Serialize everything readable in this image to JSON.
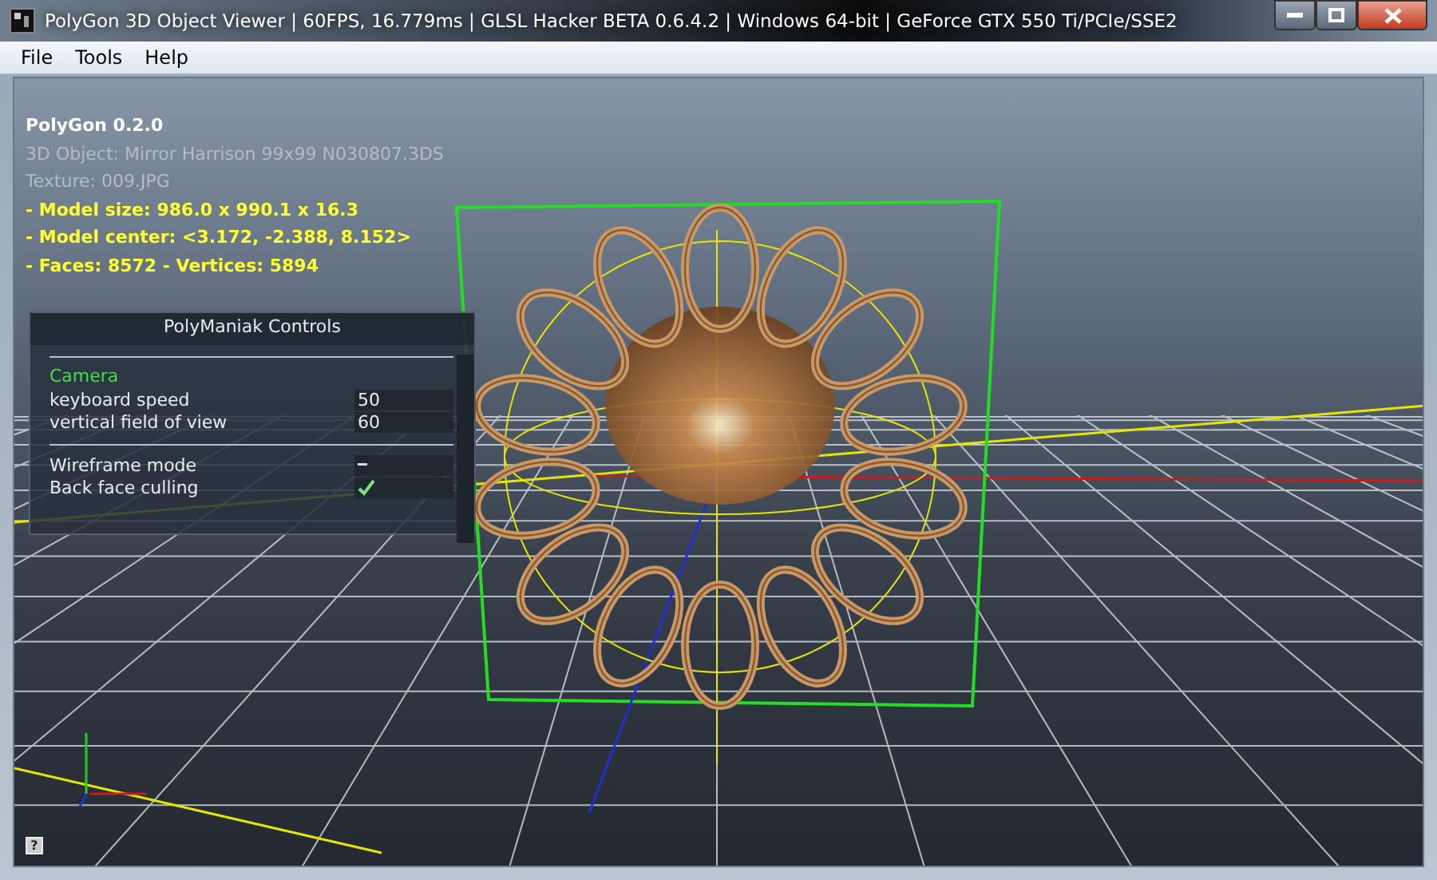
{
  "window": {
    "title": "PolyGon 3D Object Viewer | 60FPS, 16.779ms | GLSL Hacker BETA 0.6.4.2 | Windows 64-bit | GeForce GTX 550 Ti/PCIe/SSE2"
  },
  "menu": [
    "File",
    "Tools",
    "Help"
  ],
  "info_lines": [
    {
      "kind": "title",
      "text": "PolyGon 0.2.0"
    },
    {
      "kind": "dim",
      "text": "3D Object: Mirror Harrison 99x99 N030807.3DS"
    },
    {
      "kind": "dim",
      "text": "Texture: 009.JPG"
    },
    {
      "kind": "stat",
      "text": "- Model size:  986.0 x 990.1 x 16.3"
    },
    {
      "kind": "stat",
      "text": "- Model center:  <3.172, -2.388, 8.152>"
    },
    {
      "kind": "stat",
      "text": "- Faces: 8572 - Vertices: 5894"
    }
  ],
  "controls_panel": {
    "title": "PolyManiak Controls",
    "section": "Camera",
    "rows": [
      {
        "kind": "number",
        "label": "keyboard speed",
        "value": "50"
      },
      {
        "kind": "number",
        "label": "vertical field of view",
        "value": "60"
      },
      {
        "kind": "separator"
      },
      {
        "kind": "checkbox",
        "label": "Wireframe mode",
        "checked": false
      },
      {
        "kind": "checkbox",
        "label": "Back face culling",
        "checked": true
      }
    ]
  },
  "help_button": "?"
}
